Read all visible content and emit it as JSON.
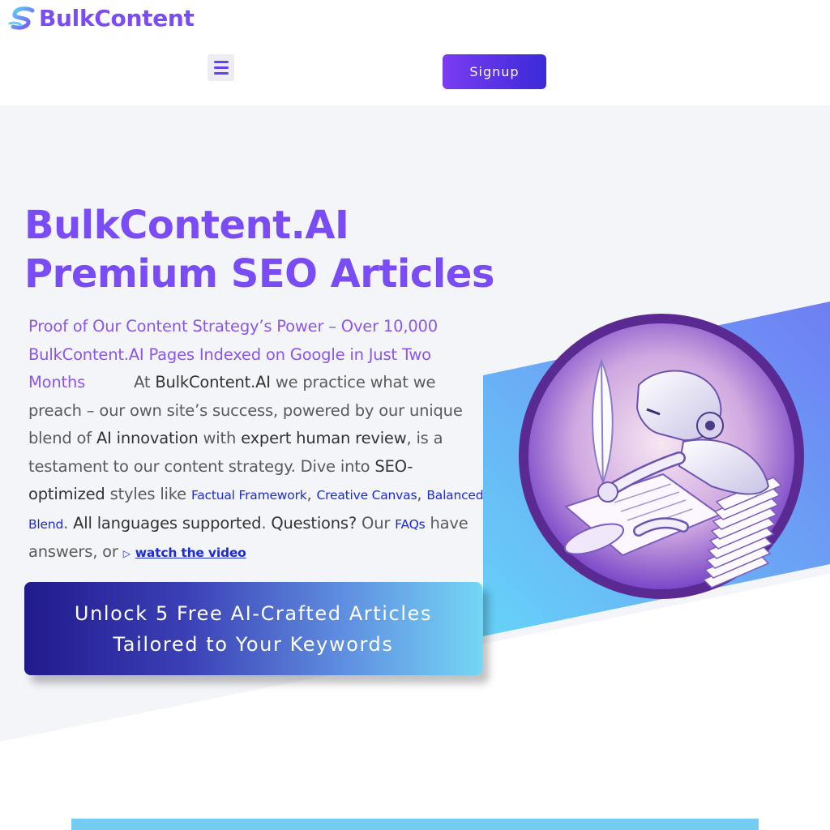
{
  "header": {
    "logo_text": "BulkContent",
    "signup_label": "Signup"
  },
  "hero": {
    "title_line1": "BulkContent.AI",
    "title_line2": "Premium SEO Articles",
    "para": {
      "accent": "Proof of Our Content Strategy’s Power – Over 10,000 BulkContent.AI Pages Indexed on Google in Just Two Months",
      "t1": "At ",
      "b1": "BulkContent.AI",
      "t2": " we practice what we preach – our own site’s success, powered by our unique blend of ",
      "b2": "AI innovation",
      "t3": " with ",
      "b3": "expert human review",
      "t4": ", is a testament to our content strategy. Dive into ",
      "b4": "SEO-optimized",
      "t5": " styles like ",
      "link1": "Factual Framework",
      "sep1": ", ",
      "link2": "Creative Canvas",
      "sep2": ", ",
      "link3": "Balanced Blend",
      "t6": ". ",
      "b5": "All languages supported",
      "t7": ". ",
      "b6": "Questions?",
      "t8": " Our ",
      "link4": "FAQs",
      "t9": " have answers, or ",
      "video_link": "watch the video"
    },
    "cta_line1": "Unlock 5 Free AI-Crafted Articles",
    "cta_line2": "Tailored to Your Keywords"
  },
  "colors": {
    "brand_purple": "#7a4cf5",
    "link_blue": "#1d2bd6",
    "cta_start": "#211a8c",
    "cta_end": "#74d6f5"
  },
  "icons": {
    "logo": "swirl-logo-icon",
    "menu": "hamburger-menu-icon",
    "video": "video-icon"
  }
}
